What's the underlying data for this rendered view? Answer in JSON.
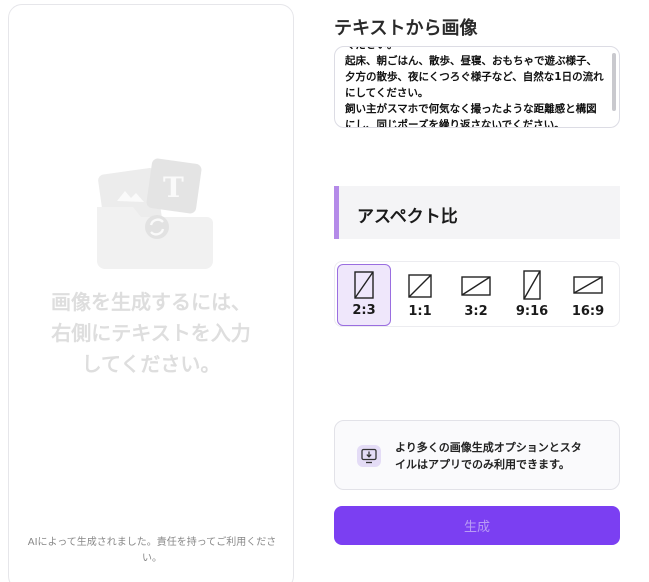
{
  "preview": {
    "message": "画像を生成するには、\n右側にテキストを入力\nしてください。",
    "disclaimer": "AIによって生成されました。責任を持ってご利用ください。"
  },
  "prompt": {
    "title": "テキストから画像",
    "text": "ください。\n起床、朝ごはん、散歩、昼寝、おもちゃで遊ぶ様子、夕方の散歩、夜にくつろぐ様子など、自然な1日の流れにしてください。\n飼い主がスマホで何気なく撮ったような距離感と構図にし、同じポーズを繰り返さないでください。"
  },
  "aspect": {
    "heading": "アスペクト比",
    "options": [
      {
        "label": "2:3",
        "selected": true
      },
      {
        "label": "1:1",
        "selected": false
      },
      {
        "label": "3:2",
        "selected": false
      },
      {
        "label": "9:16",
        "selected": false
      },
      {
        "label": "16:9",
        "selected": false
      }
    ]
  },
  "info": {
    "icon": "download-monitor-icon",
    "text": "より多くの画像生成オプションとスタ\nイルはアプリでのみ利用できます。"
  },
  "generate": {
    "label": "生成"
  },
  "colors": {
    "accent": "#7b3ff2",
    "selected_border": "#9a6ee0",
    "selected_bg": "#efe7fb"
  }
}
